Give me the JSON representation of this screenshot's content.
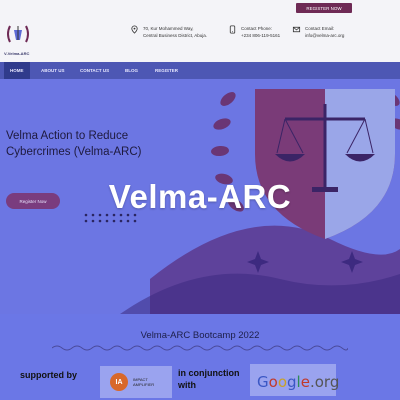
{
  "header": {
    "logo_text": "V-Velma-ARC",
    "register_label": "REGISTER NOW",
    "address_line1": "70, Kur Mohammed Way,",
    "address_line2": "Central Business District, Abuja.",
    "phone_label": "Contact Phone:",
    "phone_value": "+234 806-119-5161",
    "email_label": "Contact Email:",
    "email_value": "info@velma-arc.org"
  },
  "nav": {
    "items": [
      {
        "label": "HOME"
      },
      {
        "label": "ABOUT US"
      },
      {
        "label": "CONTACT US"
      },
      {
        "label": "BLOG"
      },
      {
        "label": "REGISTER"
      }
    ]
  },
  "hero": {
    "title_line1": "Velma Action to Reduce",
    "title_line2": "Cybercrimes (Velma-ARC)",
    "button_label": "Register Now",
    "overlay_label": "Velma-ARC"
  },
  "bottom": {
    "title": "Velma-ARC Bootcamp 2022",
    "supported_by": "supported by",
    "sponsor1_mark": "IA",
    "sponsor1_line1": "IMPACT",
    "sponsor1_line2": "AMPLIFIER",
    "conjunction_line1": "in conjunction",
    "conjunction_line2": "with",
    "sponsor2": "Google.org"
  },
  "colors": {
    "accent": "#6e2a55",
    "nav_bg": "#4d57b4",
    "hero_bg": "#6c76e3",
    "ia_orange": "#d8682a"
  }
}
